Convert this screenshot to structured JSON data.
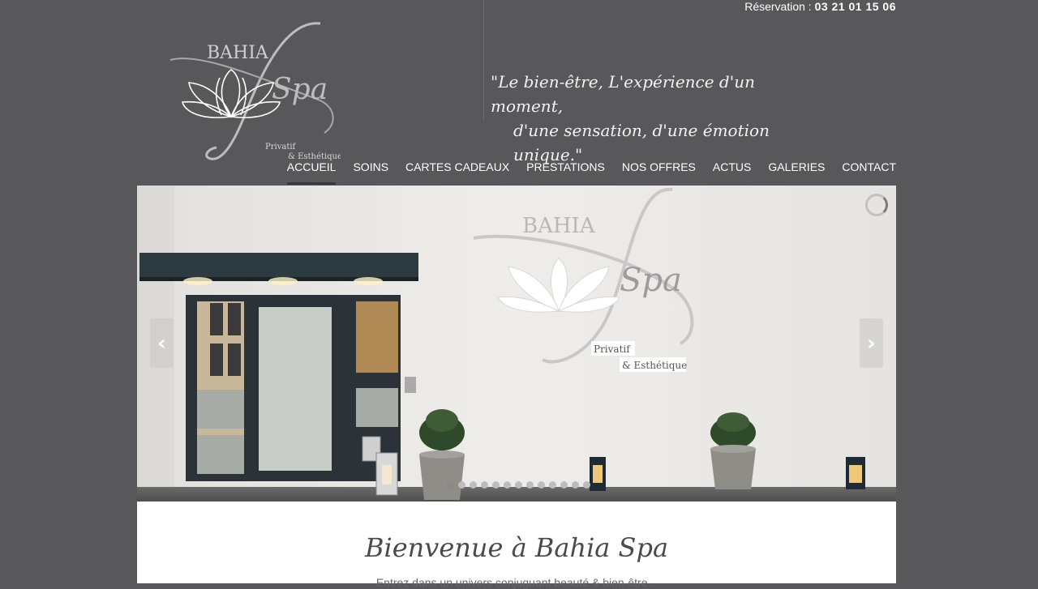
{
  "header": {
    "reservation_label": "Réservation : ",
    "reservation_phone": "03 21 01 15 06",
    "logo_brand": "BAHIA",
    "logo_script": "Spa",
    "logo_sub1": "Privatif",
    "logo_sub2": "& Esthétique",
    "tagline_line1": "\"Le bien-être, L'expérience d'un moment,",
    "tagline_line2": "d'une sensation, d'une émotion unique.\""
  },
  "nav": {
    "items": [
      {
        "label": "ACCUEIL"
      },
      {
        "label": "SOINS"
      },
      {
        "label": "CARTES CADEAUX"
      },
      {
        "label": "PRESTATIONS"
      },
      {
        "label": "NOS OFFRES"
      },
      {
        "label": "ACTUS"
      },
      {
        "label": "GALERIES"
      },
      {
        "label": "CONTACT"
      }
    ],
    "active": "ACCUEIL"
  },
  "slider": {
    "prev_icon": "chevron-left-icon",
    "next_icon": "chevron-right-icon",
    "prev_glyph": "‹",
    "next_glyph": "›",
    "slide_count": 13,
    "active_slide": 1,
    "sign_brand": "BAHIA",
    "sign_script": "Spa",
    "sign_sub1": "Privatif",
    "sign_sub2": "& Esthétique"
  },
  "content": {
    "welcome_title": "Bienvenue à Bahia Spa",
    "intro_text": "Entrez dans un univers conjuguant beauté & bien-être..."
  },
  "colors": {
    "background": "#58585a",
    "content_bg": "#ffffff",
    "nav_active_bar": "#3a3a3c"
  }
}
